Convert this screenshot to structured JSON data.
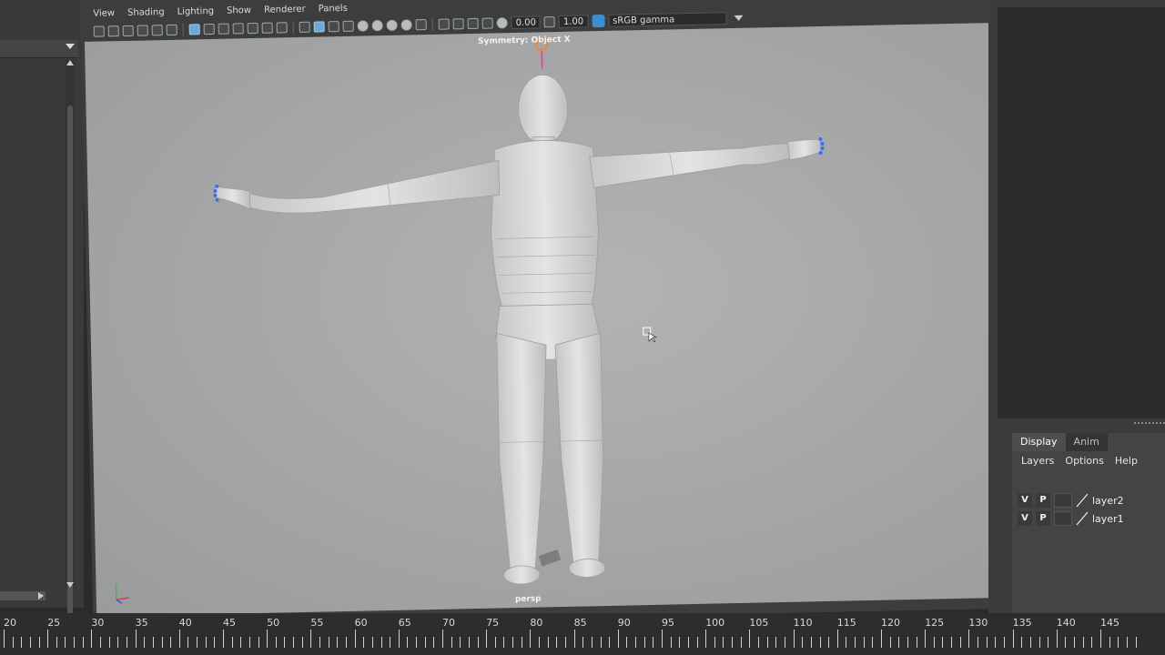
{
  "viewport_menu": {
    "view": "View",
    "shading": "Shading",
    "lighting": "Lighting",
    "show": "Show",
    "renderer": "Renderer",
    "panels": "Panels"
  },
  "toolbar": {
    "exposure_value": "0.00",
    "gamma_value": "1.00",
    "color_space": "sRGB gamma"
  },
  "viewport": {
    "symmetry_label": "Symmetry: Object X",
    "camera_label": "persp"
  },
  "layer_editor": {
    "tabs": [
      {
        "label": "Display",
        "active": true
      },
      {
        "label": "Anim",
        "active": false
      }
    ],
    "menu": [
      "Layers",
      "Options",
      "Help"
    ],
    "layers": [
      {
        "visible": "V",
        "playback": "P",
        "name": "layer2"
      },
      {
        "visible": "V",
        "playback": "P",
        "name": "layer1"
      }
    ]
  },
  "timeline": {
    "frames": [
      20,
      25,
      30,
      35,
      40,
      45,
      50,
      55,
      60,
      65,
      70,
      75,
      80,
      85,
      90,
      95,
      100,
      105,
      110,
      115,
      120,
      125,
      130,
      135,
      140,
      145
    ]
  },
  "colors": {
    "accent": "#3a8fd0",
    "viewport_bg": "#a7a8a9",
    "model": "#d9d9d9",
    "nail_marks": "#3c6cf0"
  }
}
